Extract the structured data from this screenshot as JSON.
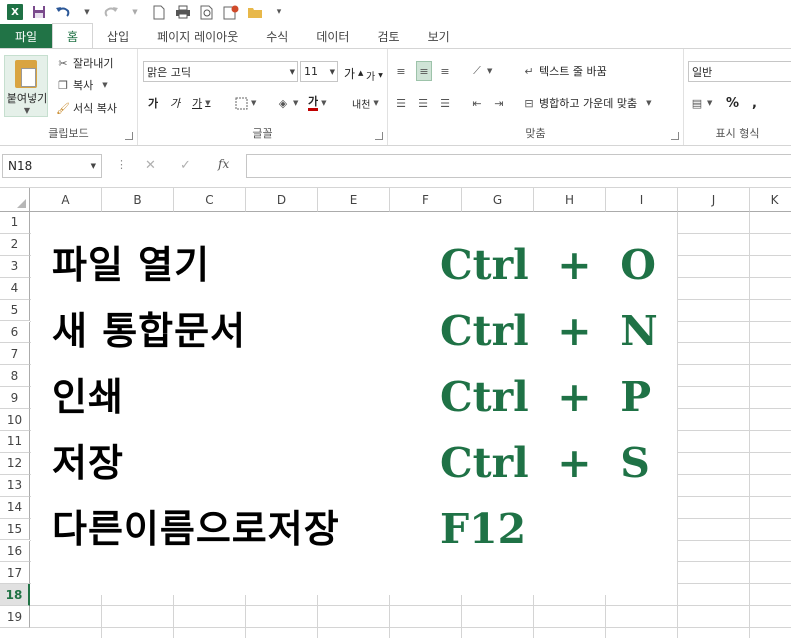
{
  "app": {
    "logo": "X",
    "quick_access_icons": [
      "save-icon",
      "undo-icon",
      "redo-icon",
      "new-document-icon",
      "print-preview-icon",
      "print-icon",
      "open-recent-icon",
      "folder-icon",
      "customize-icon"
    ]
  },
  "tabs": [
    {
      "label": "파일"
    },
    {
      "label": "홈"
    },
    {
      "label": "삽입"
    },
    {
      "label": "페이지 레이아웃"
    },
    {
      "label": "수식"
    },
    {
      "label": "데이터"
    },
    {
      "label": "검토"
    },
    {
      "label": "보기"
    }
  ],
  "ribbon": {
    "clipboard": {
      "paste_label": "붙여넣기",
      "cut_label": "잘라내기",
      "copy_label": "복사",
      "format_painter_label": "서식 복사",
      "group_label": "클립보드"
    },
    "font": {
      "font_name": "맑은 고딕",
      "font_size": "11",
      "grow_label": "가",
      "shrink_label": "가",
      "bold_label": "가",
      "italic_label": "가",
      "underline_label": "가",
      "font_color_label": "가",
      "phonetic_label": "내천",
      "group_label": "글꼴"
    },
    "alignment": {
      "wrap_text_label": "텍스트 줄 바꿈",
      "merge_center_label": "병합하고 가운데 맞춤",
      "group_label": "맞춤"
    },
    "number": {
      "format": "일반",
      "percent_label": "%",
      "comma_label": ",",
      "group_label": "표시 형식"
    }
  },
  "formula_bar": {
    "name_box": "N18",
    "fx_label": "fx",
    "content": ""
  },
  "grid": {
    "columns": [
      "A",
      "B",
      "C",
      "D",
      "E",
      "F",
      "G",
      "H",
      "I",
      "J",
      "K"
    ],
    "rows": [
      "1",
      "2",
      "3",
      "4",
      "5",
      "6",
      "7",
      "8",
      "9",
      "10",
      "11",
      "12",
      "13",
      "14",
      "15",
      "16",
      "17",
      "18",
      "19"
    ],
    "selected_row": "18",
    "accent_color": "#217346",
    "key_color": "#1f7246"
  },
  "shortcuts": [
    {
      "name": "파일 열기",
      "key": "Ctrl  +  O"
    },
    {
      "name": "새 통합문서",
      "key": "Ctrl  +  N"
    },
    {
      "name": "인쇄",
      "key": "Ctrl  +  P"
    },
    {
      "name": "저장",
      "key": "Ctrl  +  S"
    },
    {
      "name": "다른이름으로저장",
      "key": "F12"
    }
  ]
}
